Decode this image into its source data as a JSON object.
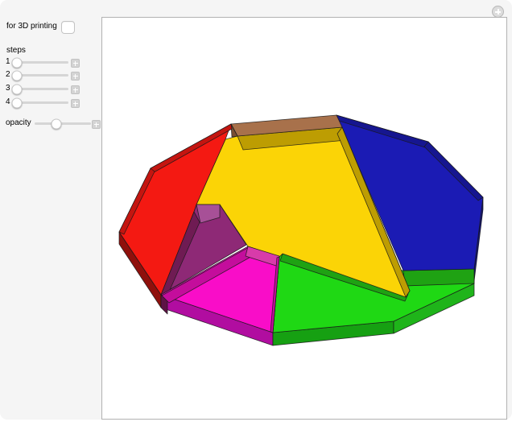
{
  "panel": {
    "for_3d_printing": {
      "label": "for 3D printing",
      "checked": false
    },
    "steps_heading": "steps",
    "step_sliders": [
      {
        "label": "1",
        "thumb_pos": "7%"
      },
      {
        "label": "2",
        "thumb_pos": "7%"
      },
      {
        "label": "3",
        "thumb_pos": "7%"
      },
      {
        "label": "4",
        "thumb_pos": "7%"
      }
    ],
    "opacity_slider": {
      "label": "opacity",
      "thumb_pos": "39%"
    }
  },
  "figure": {
    "description": "3D extruded dissection of a dodecagon into seven colored pieces",
    "pieces": {
      "red": {
        "face": "#F41912",
        "band": "#C41510",
        "wall": "#8F100C"
      },
      "brown": {
        "face": "#A8714B",
        "wall": "#7A4E33"
      },
      "yellow": {
        "face": "#FBD406",
        "band": "#BD9D02"
      },
      "blue": {
        "face": "#1B1BB4",
        "band": "#161690",
        "wall": "#12127C"
      },
      "green": {
        "face": "#1FD814",
        "band": "#1FA213",
        "wall_front": "#16A012",
        "wall_right": "#1FB41A"
      },
      "magenta": {
        "face": "#F90DC8",
        "band": "#C40D9C",
        "band_light": "#D83BAA",
        "wall": "#B10DA0"
      },
      "purple": {
        "face": "#8E2976",
        "facet": "#A75097",
        "band": "#6F1B53",
        "wall": "#5E1345"
      }
    }
  }
}
